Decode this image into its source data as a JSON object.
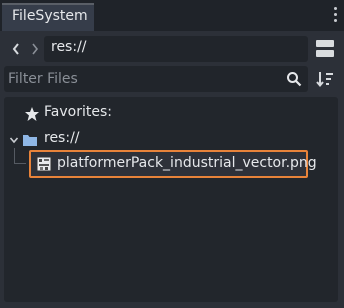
{
  "dock": {
    "tab_label": "FileSystem"
  },
  "navigation": {
    "back_icon": "chevron-left-icon",
    "forward_icon": "chevron-right-icon",
    "path": "res://",
    "split_toggle_icon": "split-mode-icon"
  },
  "filter": {
    "placeholder": "Filter Files",
    "value": "",
    "search_icon": "search-icon",
    "sort_icon": "sort-icon"
  },
  "tree": {
    "favorites_label": "Favorites:",
    "root_label": "res://",
    "file_label": "platformerPack_industrial_vector.png"
  },
  "colors": {
    "selection_outline": "#e8833a",
    "folder_icon": "#8fb7e6"
  }
}
